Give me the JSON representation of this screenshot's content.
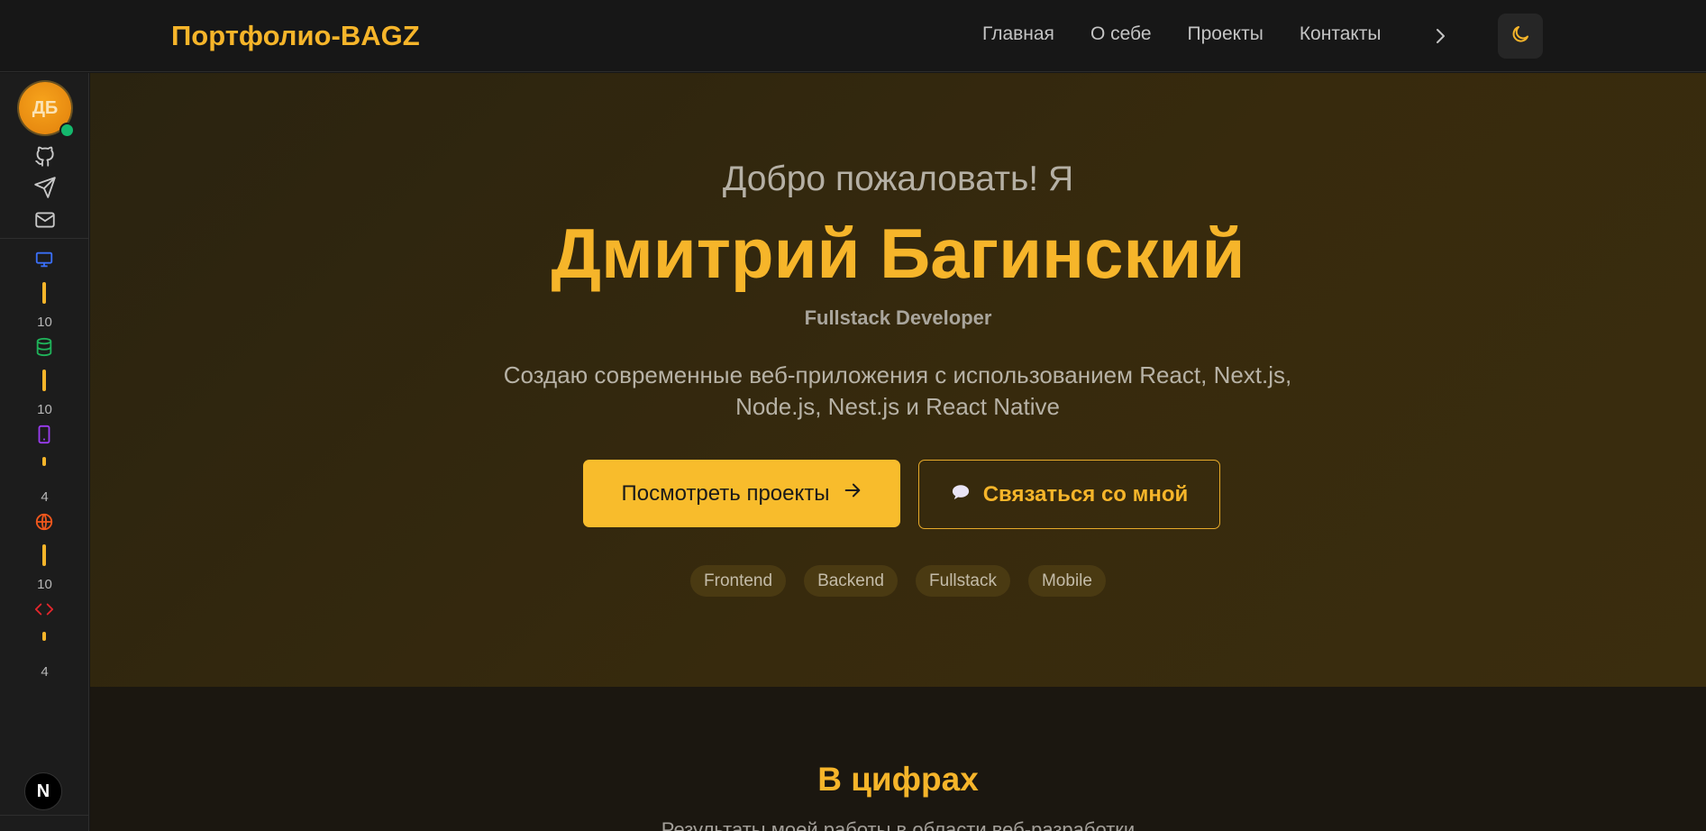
{
  "header": {
    "brand": "Портфолио-BAGZ",
    "nav": [
      "Главная",
      "О себе",
      "Проекты",
      "Контакты"
    ],
    "chevron_icon": "chevron-right-icon",
    "theme_icon": "moon-icon"
  },
  "sidebar": {
    "avatar_initials": "ДБ",
    "social_icons": [
      "github-icon",
      "telegram-icon",
      "mail-icon"
    ],
    "skills": [
      {
        "icon": "monitor-icon",
        "color": "#3a6ff7",
        "count": "10",
        "level": 10
      },
      {
        "icon": "database-icon",
        "color": "#1fb35a",
        "count": "10",
        "level": 10
      },
      {
        "icon": "smartphone-icon",
        "color": "#9a3cf0",
        "count": "4",
        "level": 4
      },
      {
        "icon": "globe-icon",
        "color": "#f0571c",
        "count": "10",
        "level": 10
      },
      {
        "icon": "code-icon",
        "color": "#e5262c",
        "count": "4",
        "level": 4
      }
    ],
    "badge": "N"
  },
  "hero": {
    "greeting": "Добро пожаловать! Я",
    "name": "Дмитрий Багинский",
    "role": "Fullstack Developer",
    "description": "Создаю современные веб-приложения с использованием React, Next.js, Node.js, Nest.js и React Native",
    "primary_button": "Посмотреть проекты",
    "secondary_button": "Связаться со мной",
    "tags": [
      "Frontend",
      "Backend",
      "Fullstack",
      "Mobile"
    ]
  },
  "stats": {
    "title": "В цифрах",
    "subtitle": "Результаты моей работы в области веб-разработки"
  },
  "colors": {
    "accent": "#f6b52a",
    "online": "#14b86d"
  }
}
